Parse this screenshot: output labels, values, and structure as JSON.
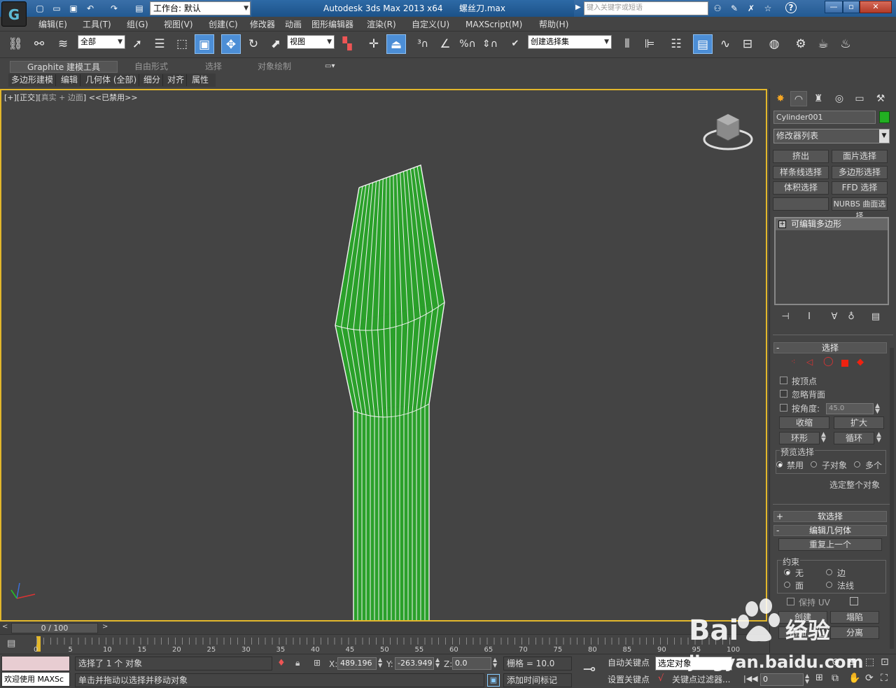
{
  "app": {
    "workspace_label": "工作台: 默认",
    "title": "Autodesk 3ds Max  2013 x64",
    "file_name": "螺丝刀.max",
    "search_placeholder": "键入关键字或短语"
  },
  "menu": [
    "编辑(E)",
    "工具(T)",
    "组(G)",
    "视图(V)",
    "创建(C)",
    "修改器",
    "动画",
    "图形编辑器",
    "渲染(R)",
    "自定义(U)",
    "MAXScript(M)",
    "帮助(H)"
  ],
  "toolbar": {
    "filter_value": "全部",
    "coord_system": "视图",
    "selection_set": "创建选择集"
  },
  "ribbon": {
    "tabs": [
      "Graphite 建模工具",
      "自由形式",
      "选择",
      "对象绘制"
    ],
    "sub_tabs": [
      "多边形建模",
      "编辑",
      "几何体 (全部)",
      "细分",
      "对齐",
      "属性"
    ]
  },
  "viewport": {
    "label_a": "[+][正交][",
    "label_b": "真实 + 边面",
    "label_c": "] <<已禁用>>",
    "object_color": "#2aa02a"
  },
  "command_panel": {
    "object_name": "Cylinder001",
    "object_color": "#22b022",
    "modifier_list": "修改器列表",
    "modifier_buttons": [
      "挤出",
      "面片选择",
      "样条线选择",
      "多边形选择",
      "体积选择",
      "FFD 选择",
      "",
      "NURBS 曲面选择"
    ],
    "stack_item": "可编辑多边形",
    "selection_rollout": {
      "title": "选择",
      "by_vertex": "按顶点",
      "ignore_backfacing": "忽略背面",
      "by_angle": "按角度:",
      "angle_value": "45.0",
      "shrink": "收缩",
      "grow": "扩大",
      "ring": "环形",
      "loop": "循环",
      "preview_title": "预览选择",
      "preview_disable": "禁用",
      "preview_subobj": "子对象",
      "preview_multi": "多个",
      "select_whole": "选定整个对象"
    },
    "soft_selection": "软选择",
    "edit_geometry": {
      "title": "编辑几何体",
      "repeat_last": "重复上一个",
      "constraints_title": "约束",
      "none": "无",
      "edge": "边",
      "face": "面",
      "normal": "法线",
      "preserve_uv": "保持 UV",
      "create": "创建",
      "collapse": "塌陷",
      "attach": "附加",
      "detach": "分离"
    }
  },
  "timeline": {
    "frame_display": "0 / 100",
    "ticks": [
      "0",
      "5",
      "10",
      "15",
      "20",
      "25",
      "30",
      "35",
      "40",
      "45",
      "50",
      "55",
      "60",
      "65",
      "70",
      "75",
      "80",
      "85",
      "90",
      "95",
      "100"
    ]
  },
  "status": {
    "selected": "选择了 1 个 对象",
    "hint": "单击并拖动以选择并移动对象",
    "welcome": "欢迎使用  MAXSc",
    "x_label": "X:",
    "x_value": "489.196",
    "y_label": "Y:",
    "y_value": "-263.949",
    "z_label": "Z:",
    "z_value": "0.0",
    "grid": "栅格 = 10.0",
    "add_time_tag": "添加时间标记",
    "auto_key": "自动关键点",
    "set_key": "设置关键点",
    "selected_obj": "选定对象",
    "key_filters": "关键点过滤器...",
    "frame_value": "0"
  },
  "watermark": {
    "brand": "Bai",
    "brand_cn": "经验",
    "url": "jingyan.baidu.com"
  }
}
